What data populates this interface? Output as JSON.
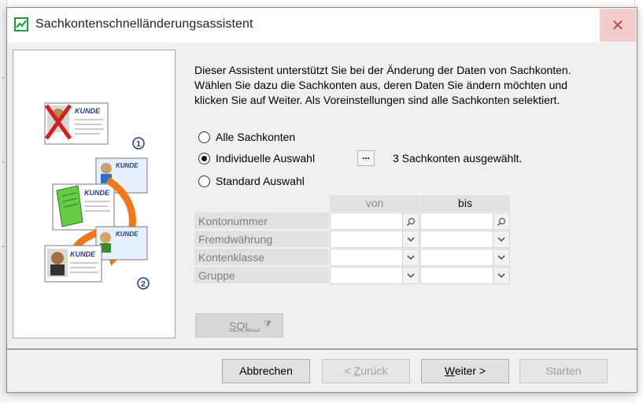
{
  "window": {
    "title": "Sachkontenschnelländerungsassistent",
    "close_glyph": "✕"
  },
  "intro": {
    "lines": [
      "Dieser Assistent unterstützt Sie bei der Änderung der Daten von Sachkonten.",
      "Wählen Sie dazu die Sachkonten aus, deren Daten Sie ändern möchten und",
      "klicken Sie auf Weiter. Als Voreinstellungen sind alle Sachkonten selektiert."
    ]
  },
  "selection": {
    "options": [
      {
        "label": "Alle Sachkonten",
        "checked": false
      },
      {
        "label": "Individuelle Auswahl",
        "checked": true
      },
      {
        "label": "Standard Auswahl",
        "checked": false
      }
    ],
    "browse_label": "...",
    "selected_info": "3 Sachkonten ausgewählt."
  },
  "illustration": {
    "card_label": "KUNDE",
    "step1": "1",
    "step2": "2"
  },
  "criteria": {
    "col_from": "von",
    "col_to": "bis",
    "rows": [
      {
        "label": "Kontonummer",
        "kind": "search-icon",
        "from": "",
        "to": ""
      },
      {
        "label": "Fremdwährung",
        "kind": "chevron-down-icon",
        "from": "",
        "to": ""
      },
      {
        "label": "Kontenklasse",
        "kind": "chevron-down-icon",
        "from": "",
        "to": ""
      },
      {
        "label": "Gruppe",
        "kind": "chevron-down-icon",
        "from": "",
        "to": ""
      }
    ]
  },
  "sql": {
    "label": "SQL...",
    "icon": "filter-icon"
  },
  "footer": {
    "cancel": "Abbrechen",
    "back_prefix": "< ",
    "back_hot": "Z",
    "back_rest": "urück",
    "next_hot": "W",
    "next_rest": "eiter >",
    "start": "Starten"
  }
}
